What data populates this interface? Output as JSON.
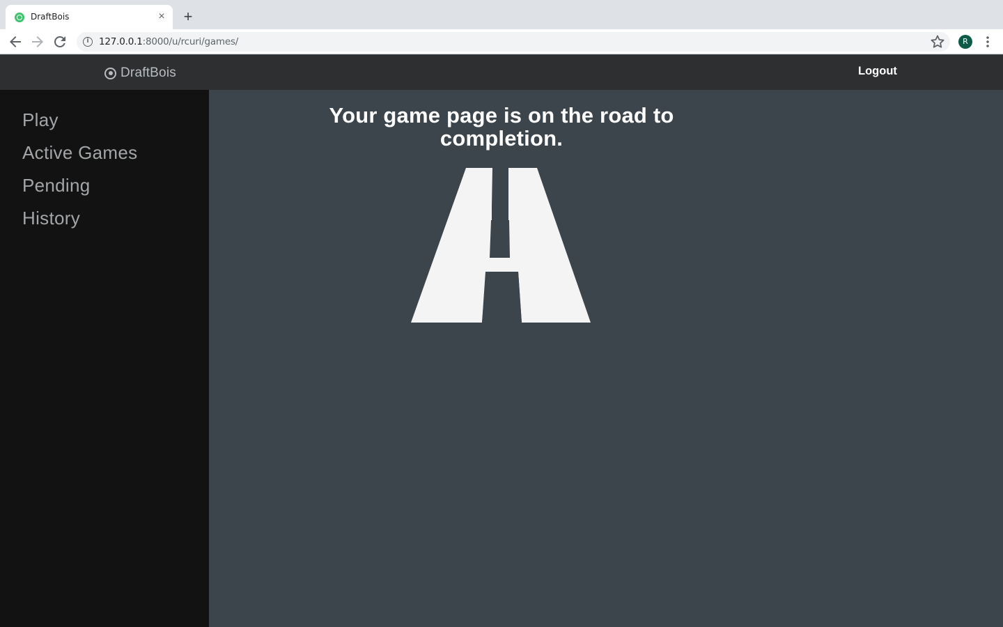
{
  "browser": {
    "tab_title": "DraftBois",
    "tab_close": "×",
    "new_tab": "+",
    "url_host": "127.0.0.1",
    "url_rest": ":8000/u/rcuri/games/",
    "avatar_letter": "R",
    "favicon_color": "#3ec46d",
    "avatar_color": "#0d5a46"
  },
  "header": {
    "brand": "DraftBois",
    "logout": "Logout",
    "background": "#2d2f31"
  },
  "sidebar": {
    "items": [
      {
        "label": "Play"
      },
      {
        "label": "Active Games"
      },
      {
        "label": "Pending"
      },
      {
        "label": "History"
      }
    ],
    "background": "#121212"
  },
  "main": {
    "headline": "Your game page is on the road to completion.",
    "illustration": "road-icon",
    "background": "#3d454c"
  }
}
